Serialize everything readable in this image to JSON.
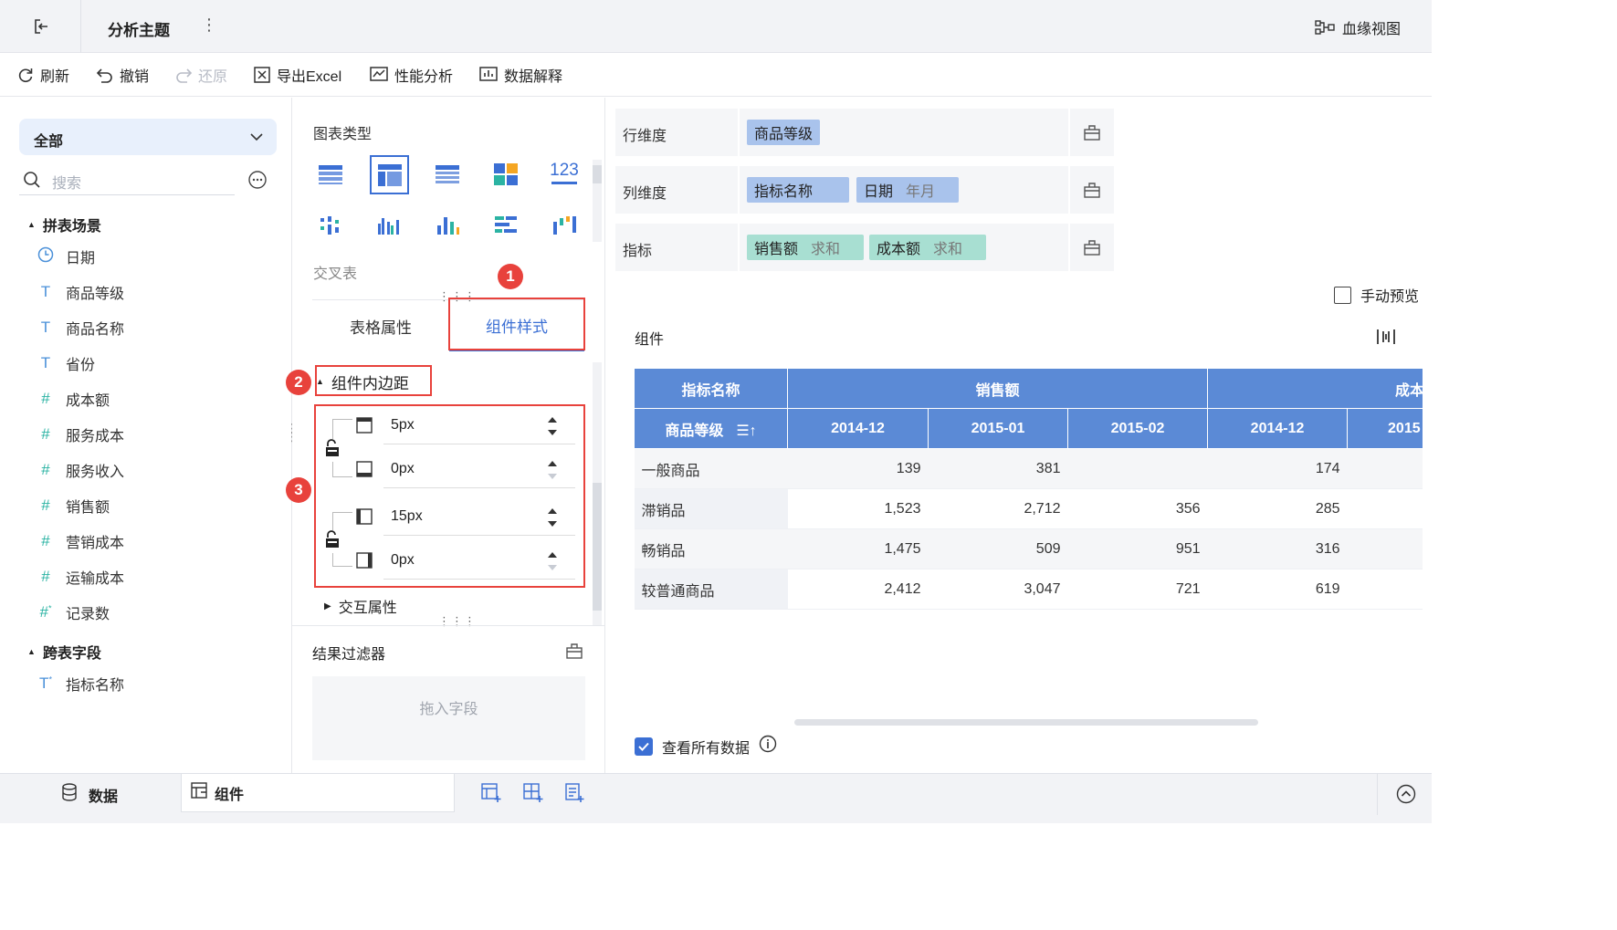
{
  "titlebar": {
    "title": "分析主题",
    "lineage_label": "血缘视图"
  },
  "toolbar": {
    "refresh": "刷新",
    "undo": "撤销",
    "redo": "还原",
    "export_excel": "导出Excel",
    "performance": "性能分析",
    "data_explain": "数据解释"
  },
  "left": {
    "dataset_select": "全部",
    "search_placeholder": "搜索",
    "group1": "拼表场景",
    "fields": [
      {
        "icon": "clock",
        "label": "日期"
      },
      {
        "icon": "T",
        "label": "商品等级"
      },
      {
        "icon": "T",
        "label": "商品名称"
      },
      {
        "icon": "T",
        "label": "省份"
      },
      {
        "icon": "#",
        "label": "成本额"
      },
      {
        "icon": "#",
        "label": "服务成本"
      },
      {
        "icon": "#",
        "label": "服务收入"
      },
      {
        "icon": "#",
        "label": "销售额"
      },
      {
        "icon": "#",
        "label": "营销成本"
      },
      {
        "icon": "#",
        "label": "运输成本"
      },
      {
        "icon": "#*",
        "label": "记录数"
      }
    ],
    "group2": "跨表字段",
    "cross_fields": [
      {
        "icon": "T*",
        "label": "指标名称"
      }
    ]
  },
  "mid": {
    "chart_type_title": "图表类型",
    "chart_type_name": "交叉表",
    "tab_table_props": "表格属性",
    "tab_component_style": "组件样式",
    "padding_section": "组件内边距",
    "paddings": [
      "5px",
      "0px",
      "15px",
      "0px"
    ],
    "interaction_section": "交互属性",
    "result_filter": "结果过滤器",
    "drop_hint": "拖入字段",
    "badges": [
      "1",
      "2",
      "3"
    ]
  },
  "right": {
    "row_dim_label": "行维度",
    "col_dim_label": "列维度",
    "measure_label": "指标",
    "row_chips": [
      {
        "text": "商品等级",
        "sub": ""
      }
    ],
    "col_chips": [
      {
        "text": "指标名称",
        "sub": ""
      },
      {
        "text": "日期",
        "sub": "年月"
      }
    ],
    "measure_chips": [
      {
        "text": "销售额",
        "sub": "求和"
      },
      {
        "text": "成本额",
        "sub": "求和"
      }
    ],
    "manual_preview": "手动预览",
    "component_title": "组件",
    "table": {
      "header1": [
        "指标名称",
        "销售额",
        "成本"
      ],
      "header2_first": "商品等级",
      "header2": [
        "2014-12",
        "2015-01",
        "2015-02",
        "2014-12",
        "2015"
      ],
      "rows": [
        [
          "一般商品",
          "139",
          "381",
          "",
          "174"
        ],
        [
          "滞销品",
          "1,523",
          "2,712",
          "356",
          "285"
        ],
        [
          "畅销品",
          "1,475",
          "509",
          "951",
          "316"
        ],
        [
          "较普通商品",
          "2,412",
          "3,047",
          "721",
          "619"
        ]
      ]
    },
    "view_all_data": "查看所有数据"
  },
  "bottom": {
    "tab_data": "数据",
    "tab_component": "组件"
  },
  "colors": {
    "accent": "#3b6fd4",
    "header_blue": "#5b8ad6",
    "chip_blue": "#a9c3ec",
    "chip_green": "#a8dfd2",
    "badge_red": "#e8423c"
  }
}
